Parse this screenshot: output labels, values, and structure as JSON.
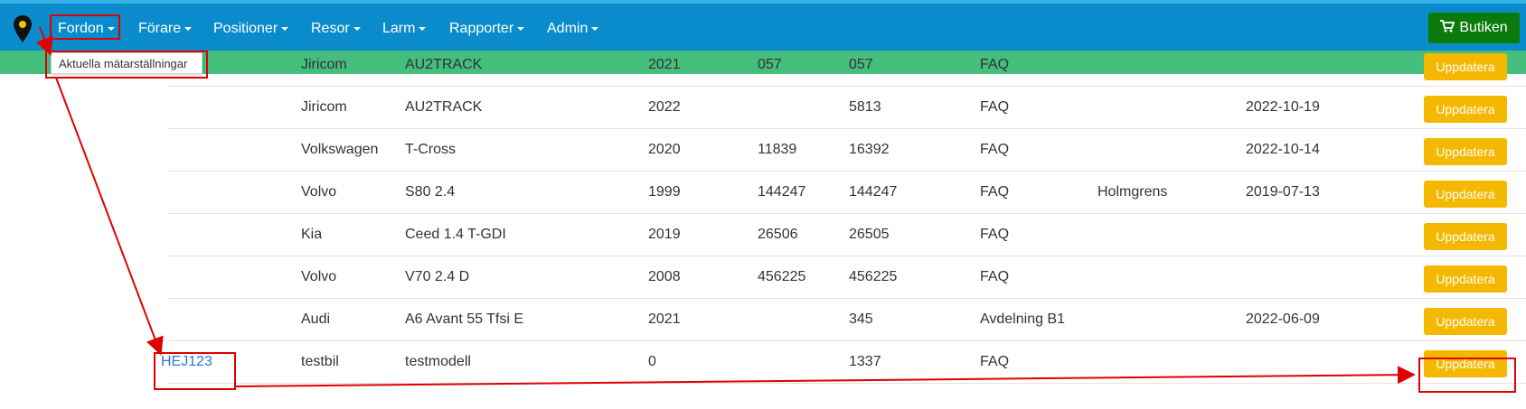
{
  "navbar": {
    "menus": [
      "Fordon",
      "Förare",
      "Positioner",
      "Resor",
      "Larm",
      "Rapporter",
      "Admin"
    ],
    "shop_label": "Butiken",
    "logo_icon": "map-marker-icon",
    "shop_icon": "cart-icon"
  },
  "dropdown": {
    "item": "Aktuella mätarställningar"
  },
  "table": {
    "rows": [
      {
        "reg": "",
        "brand": "Jiricom",
        "model": "AU2TRACK",
        "year": "2021",
        "start": "057",
        "current": "057",
        "group": "FAQ",
        "driver": "",
        "date": "",
        "button": "Uppdatera"
      },
      {
        "reg": "",
        "brand": "Jiricom",
        "model": "AU2TRACK",
        "year": "2022",
        "start": "",
        "current": "5813",
        "group": "FAQ",
        "driver": "",
        "date": "2022-10-19",
        "button": "Uppdatera"
      },
      {
        "reg": "",
        "brand": "Volkswagen",
        "model": "T-Cross",
        "year": "2020",
        "start": "11839",
        "current": "16392",
        "group": "FAQ",
        "driver": "",
        "date": "2022-10-14",
        "button": "Uppdatera"
      },
      {
        "reg": "",
        "brand": "Volvo",
        "model": "S80 2.4",
        "year": "1999",
        "start": "144247",
        "current": "144247",
        "group": "FAQ",
        "driver": "Holmgrens",
        "date": "2019-07-13",
        "button": "Uppdatera"
      },
      {
        "reg": "",
        "brand": "Kia",
        "model": "Ceed 1.4 T-GDI",
        "year": "2019",
        "start": "26506",
        "current": "26505",
        "group": "FAQ",
        "driver": "",
        "date": "",
        "button": "Uppdatera"
      },
      {
        "reg": "",
        "brand": "Volvo",
        "model": "V70 2.4 D",
        "year": "2008",
        "start": "456225",
        "current": "456225",
        "group": "FAQ",
        "driver": "",
        "date": "",
        "button": "Uppdatera"
      },
      {
        "reg": "",
        "brand": "Audi",
        "model": "A6 Avant 55 Tfsi E",
        "year": "2021",
        "start": "",
        "current": "345",
        "group": "Avdelning B1",
        "driver": "",
        "date": "2022-06-09",
        "button": "Uppdatera"
      },
      {
        "reg": "HEJ123",
        "brand": "testbil",
        "model": "testmodell",
        "year": "0",
        "start": "",
        "current": "1337",
        "group": "FAQ",
        "driver": "",
        "date": "",
        "button": "Uppdatera"
      }
    ]
  },
  "colors": {
    "navbar": "#0a8ccc",
    "greenbar": "#45bd7c",
    "button": "#f5b800",
    "shop": "#0a7a0a",
    "highlight": "#e00000"
  }
}
